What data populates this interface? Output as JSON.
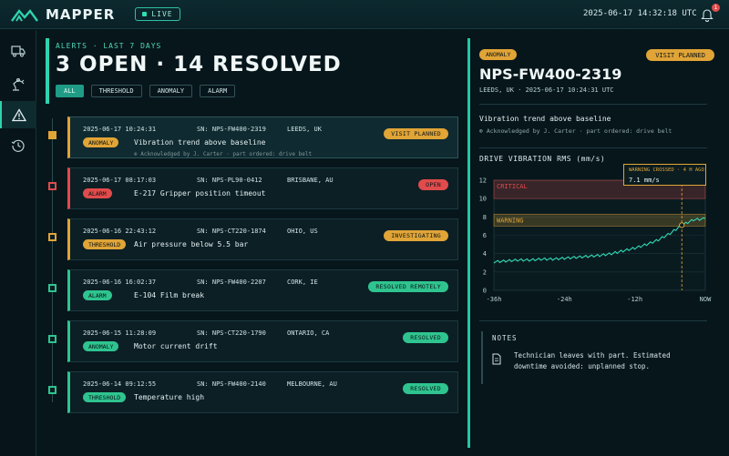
{
  "app": {
    "name": "MAPPER",
    "live_label": "LIVE",
    "clock": "2025-06-17 14:32:18 UTC",
    "notification_count": "1"
  },
  "colors": {
    "accent": "#2fd3ae",
    "amber": "#e0a437",
    "red": "#e04b4b",
    "green": "#2fc48f"
  },
  "sidebar": {
    "items": [
      {
        "icon": "truck-icon"
      },
      {
        "icon": "robot-arm-icon"
      },
      {
        "icon": "alert-triangle-icon",
        "active": true
      },
      {
        "icon": "history-icon"
      }
    ]
  },
  "alerts_header": {
    "caption": "ALERTS · LAST 7 DAYS",
    "title": "3 OPEN · 14 RESOLVED",
    "filters": [
      "ALL",
      "THRESHOLD",
      "ANOMALY",
      "ALARM"
    ],
    "active_filter": "ALL"
  },
  "alerts": [
    {
      "date": "2025-06-17  10:24:31",
      "sn": "SN: NPS-FW400-2319",
      "loc": "LEEDS, UK",
      "type": "ANOMALY",
      "title": "Vibration trend above baseline",
      "ack": "⊕ Acknowledged by J. Carter  ·  part ordered: drive belt",
      "status": "VISIT PLANNED",
      "level": "amber",
      "selected": true
    },
    {
      "date": "2025-06-17  08:17:03",
      "sn": "SN: NPS-PL90-0412",
      "loc": "BRISBANE, AU",
      "type": "ALARM",
      "title": "E-217 Gripper position timeout",
      "ack": "",
      "status": "OPEN",
      "level": "red"
    },
    {
      "date": "2025-06-16  22:43:12",
      "sn": "SN: NPS-CT220-1874",
      "loc": "OHIO, US",
      "type": "THRESHOLD",
      "title": "Air pressure below 5.5 bar",
      "ack": "",
      "status": "INVESTIGATING",
      "level": "amber"
    },
    {
      "date": "2025-06-16  16:02:37",
      "sn": "SN: NPS-FW400-2207",
      "loc": "CORK, IE",
      "type": "ALARM",
      "title": "E-104 Film break",
      "ack": "",
      "status": "RESOLVED REMOTELY",
      "level": "green"
    },
    {
      "date": "2025-06-15  11:28:09",
      "sn": "SN: NPS-CT220-1790",
      "loc": "ONTARIO, CA",
      "type": "ANOMALY",
      "title": "Motor current drift",
      "ack": "",
      "status": "RESOLVED",
      "level": "green"
    },
    {
      "date": "2025-06-14  09:12:55",
      "sn": "SN: NPS-FW400-2140",
      "loc": "MELBOURNE, AU",
      "type": "THRESHOLD",
      "title": "Temperature high",
      "ack": "",
      "status": "RESOLVED",
      "level": "green"
    }
  ],
  "detail": {
    "badge": "ANOMALY",
    "status": "VISIT PLANNED",
    "sn": "NPS-FW400-2319",
    "meta": "LEEDS, UK  ·  2025-06-17  10:24:31  UTC",
    "description": "Vibration trend above baseline",
    "ack": "⊕ Acknowledged by J. Carter  ·  part ordered: drive belt",
    "chart_title": "DRIVE VIBRATION RMS (mm/s)",
    "tooltip_label": "WARNING CROSSED · 4 H AGO",
    "tooltip_value": "7.1 mm/s",
    "notes_title": "NOTES",
    "notes_text": "Technician leaves with part.  Estimated downtime avoided: unplanned stop."
  },
  "chart_data": {
    "type": "line",
    "title": "DRIVE VIBRATION RMS (mm/s)",
    "x_ticks": [
      "-36h",
      "-24h",
      "-12h",
      "NOW"
    ],
    "y_ticks": [
      0,
      2,
      4,
      6,
      8,
      10,
      12
    ],
    "ylim": [
      0,
      12
    ],
    "xlim": [
      -36,
      0
    ],
    "bands": [
      {
        "name": "CRITICAL",
        "from": 10,
        "to": 12,
        "color": "#e04b4b"
      },
      {
        "name": "WARNING",
        "from": 7,
        "to": 8.3,
        "color": "#e0a437"
      }
    ],
    "marker": {
      "x": -4,
      "y": 7.1
    },
    "series": [
      {
        "x": [
          -36,
          -34,
          -32,
          -30,
          -28,
          -26,
          -24,
          -22,
          -20,
          -18,
          -16,
          -14,
          -12,
          -10,
          -8,
          -6,
          -4,
          -2,
          0
        ],
        "y": [
          3.1,
          3.2,
          3.3,
          3.3,
          3.4,
          3.4,
          3.5,
          3.6,
          3.7,
          3.8,
          4.0,
          4.3,
          4.6,
          5.0,
          5.5,
          6.2,
          7.1,
          7.7,
          7.8
        ]
      }
    ]
  }
}
